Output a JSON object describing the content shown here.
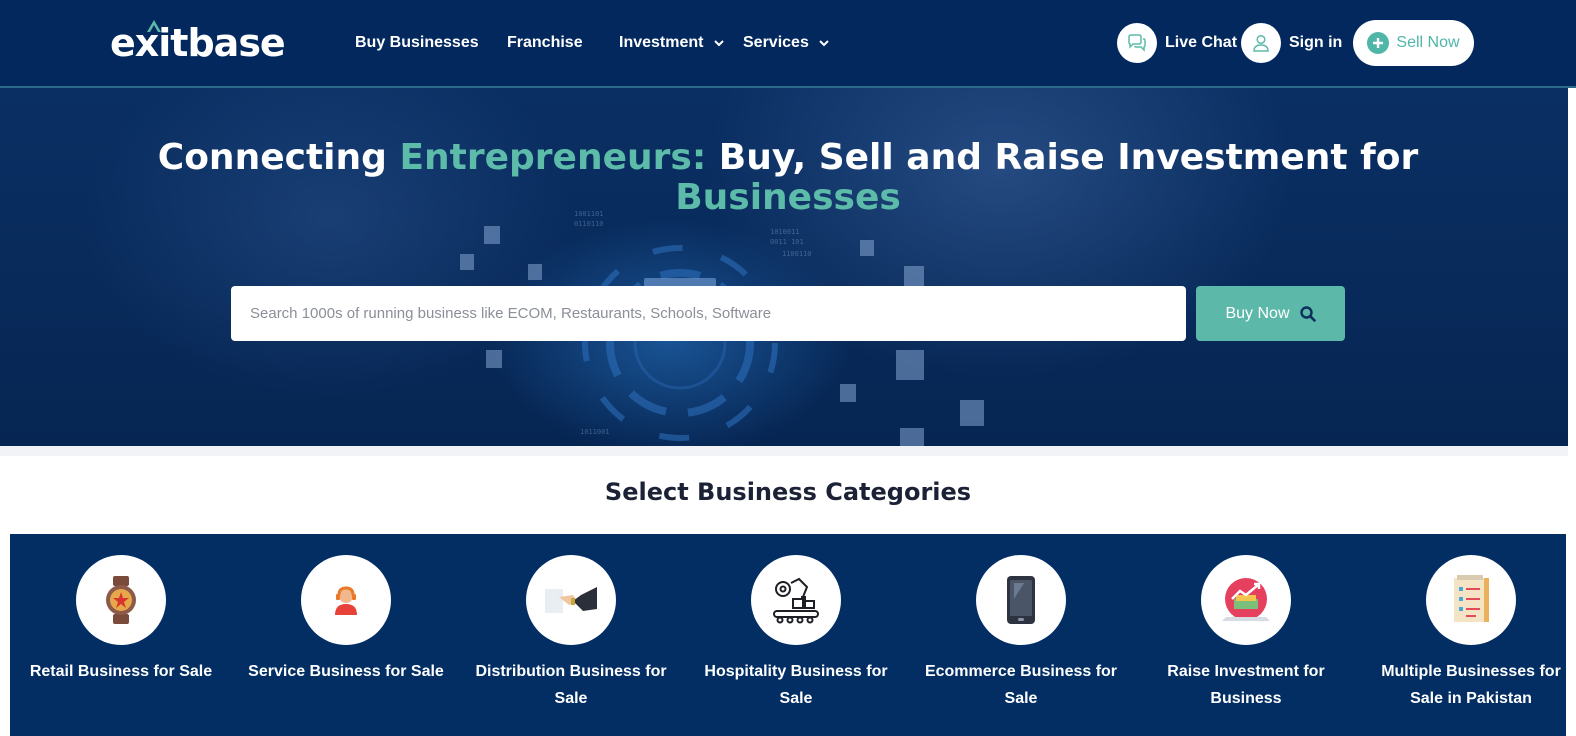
{
  "header": {
    "logo_text": "exitbase",
    "nav": [
      {
        "label": "Buy Businesses",
        "has_dropdown": false
      },
      {
        "label": "Franchise",
        "has_dropdown": false
      },
      {
        "label": "Investment",
        "has_dropdown": true
      },
      {
        "label": "Services",
        "has_dropdown": true
      }
    ],
    "live_chat_label": "Live Chat",
    "sign_in_label": "Sign in",
    "sell_now_label": "Sell Now"
  },
  "hero": {
    "title_part1": "Connecting ",
    "title_highlight1": "Entrepreneurs:",
    "title_part2": " Buy, Sell and Raise Investment for",
    "title_highlight2": "Businesses",
    "search_placeholder": "Search 1000s of running business like ECOM, Restaurants, Schools, Software",
    "search_value": "",
    "buy_now_label": "Buy Now"
  },
  "categories": {
    "title": "Select Business Categories",
    "items": [
      {
        "label": "Retail Business for Sale",
        "icon": "watch-badge-icon"
      },
      {
        "label": "Service Business for Sale",
        "icon": "support-agent-icon"
      },
      {
        "label": "Distribution Business for Sale",
        "icon": "handshake-icon"
      },
      {
        "label": "Hospitality Business for Sale",
        "icon": "robot-arm-conveyor-icon"
      },
      {
        "label": "Ecommerce Business for Sale",
        "icon": "smartphone-icon"
      },
      {
        "label": "Raise Investment for Business",
        "icon": "growth-money-icon"
      },
      {
        "label": "Multiple Businesses for Sale in Pakistan",
        "icon": "checklist-icon"
      }
    ]
  },
  "colors": {
    "header_bg": "#02285e",
    "accent": "#5cbba9",
    "categories_bg": "#022e64"
  }
}
